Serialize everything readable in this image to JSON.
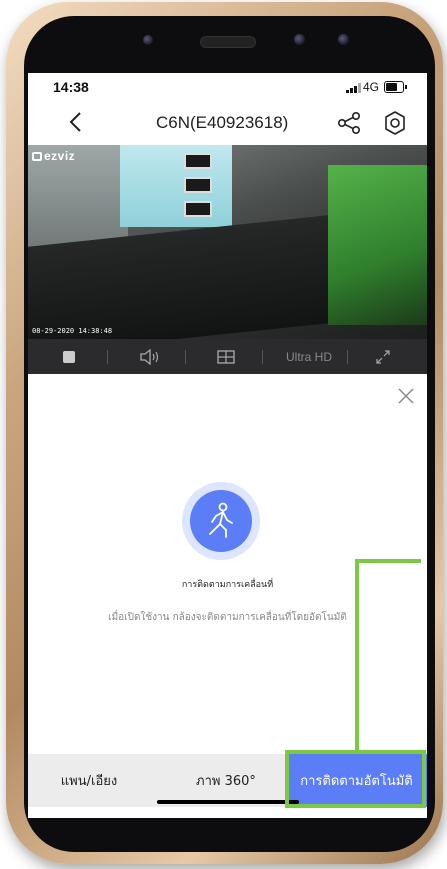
{
  "status_bar": {
    "time": "14:38",
    "network": "4G"
  },
  "nav": {
    "title": "C6N(E40923618)",
    "icons": [
      "back-chevron-icon",
      "share-icon",
      "settings-icon"
    ]
  },
  "video": {
    "brand": "ezviz",
    "timestamp": "08-29-2020 14:38:48"
  },
  "controls": {
    "quality_label": "Ultra HD",
    "icons": [
      "stop-icon",
      "volume-icon",
      "split-screen-icon",
      "fullscreen-icon"
    ]
  },
  "feature": {
    "title": "การติดตามการเคลื่อนที่",
    "description": "เมื่อเปิดใช้งาน กล้องจะติดตามการเคลื่อนที่โดยอัตโนมัติ",
    "icon": "motion-tracking-icon"
  },
  "tabs": [
    {
      "label": "แพน/เอียง"
    },
    {
      "label": "ภาพ 360°"
    },
    {
      "label": "การติดตามอัตโนมัติ",
      "active": true
    }
  ],
  "colors": {
    "accent": "#5b7df5",
    "annotation": "#7ac943",
    "control_bar": "#2b2b2d"
  }
}
